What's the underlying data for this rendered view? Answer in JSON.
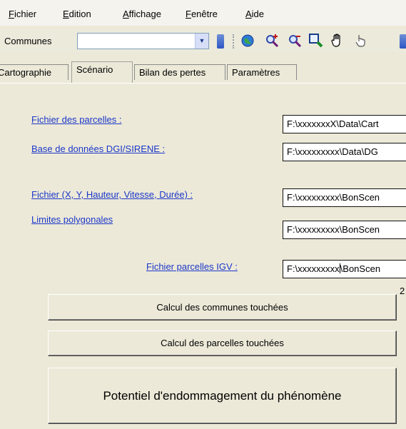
{
  "menu": [
    "Fichier",
    "Edition",
    "Affichage",
    "Fenêtre",
    "Aide"
  ],
  "toolbar": {
    "combo_label": "Communes",
    "combo_value": "",
    "tools": [
      "globe-icon",
      "zoom-in-icon",
      "zoom-out-icon",
      "magnifier-icon",
      "hand-pan-icon",
      "pointer-hand-icon"
    ]
  },
  "tabs": [
    {
      "label": "Cartographie",
      "active": false
    },
    {
      "label": "Scénario",
      "active": true
    },
    {
      "label": "Bilan des pertes",
      "active": false
    },
    {
      "label": "Paramètres",
      "active": false
    }
  ],
  "fields": {
    "parcelles": {
      "label": "Fichier des parcelles :",
      "value": "F:\\xxxxxxxX\\Data\\Cart"
    },
    "dgi": {
      "label": "Base de données DGI/SIRENE :",
      "value": "F:\\xxxxxxxxx\\Data\\DG"
    },
    "xyh": {
      "label": "Fichier (X, Y, Hauteur, Vitesse, Durée) :",
      "value": "F:\\xxxxxxxxx\\BonScen"
    },
    "limites": {
      "label": "Limites polygonales",
      "value": "F:\\xxxxxxxxx\\BonScen"
    },
    "igv": {
      "label": "Fichier parcelles IGV :",
      "value_before_caret": "F:\\xxxxxxxxx",
      "value_after_caret": "\\BonScen"
    }
  },
  "buttons": {
    "communes": "Calcul des communes touchées",
    "parcelles": "Calcul des parcelles touchées",
    "potentiel": "Potentiel d'endommagement du phénomène"
  },
  "side_number": "2",
  "colors": {
    "link": "#1b37c9",
    "window_bg": "#ece9d8",
    "grip": "#2d57c4"
  }
}
